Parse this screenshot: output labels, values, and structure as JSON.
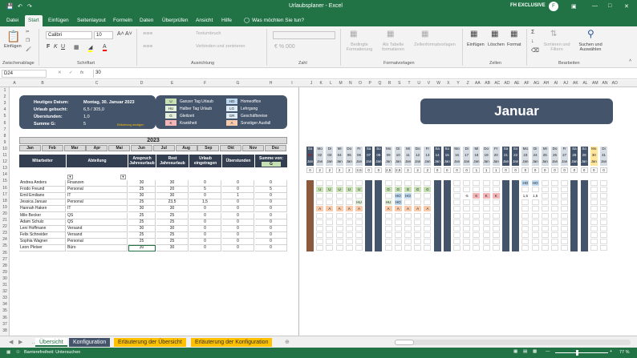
{
  "titlebar": {
    "autosave": "",
    "filename": "Urlaubsplaner - Excel",
    "user": "FH EXCLUSIVE"
  },
  "tabs": [
    "Datei",
    "Start",
    "Einfügen",
    "Seitenlayout",
    "Formeln",
    "Daten",
    "Überprüfen",
    "Ansicht",
    "Hilfe",
    "Was möchten Sie tun?"
  ],
  "ribbon": {
    "paste": "Einfügen",
    "font": "Calibri",
    "size": "10",
    "wrap": "Textumbruch",
    "merge": "Verbinden und zentrieren",
    "cond": "Bedingte Formatierung",
    "astable": "Als Tabelle formatieren",
    "cellstyles": "Zellenformatvorlagen",
    "insert": "Einfügen",
    "delete": "Löschen",
    "format": "Format",
    "sort": "Sortieren und Filtern",
    "find": "Suchen und Auswählen",
    "groups": [
      "Zwischenablage",
      "Schriftart",
      "Ausrichtung",
      "Zahl",
      "Formatvorlagen",
      "Zellen",
      "Bearbeiten"
    ]
  },
  "formula": {
    "namebox": "D24",
    "fx": "fx",
    "value": "30"
  },
  "columns": [
    "A",
    "B",
    "C",
    "D",
    "E",
    "F",
    "G",
    "H",
    "I",
    "J",
    "K",
    "L",
    "M",
    "N",
    "O",
    "P",
    "Q",
    "R",
    "S",
    "T",
    "U",
    "V",
    "W",
    "X",
    "Y",
    "Z",
    "AA",
    "AB",
    "AC",
    "AD",
    "AE",
    "AF",
    "AG",
    "AH",
    "AI",
    "AJ",
    "AK",
    "AL",
    "AM",
    "AN",
    "AO"
  ],
  "rows": [
    "1",
    "2",
    "3",
    "4",
    "5",
    "6",
    "7",
    "8",
    "9",
    "10",
    "11",
    "12",
    "13",
    "14",
    "15",
    "16",
    "17",
    "18",
    "19",
    "20",
    "21",
    "22",
    "23",
    "24",
    "25",
    "26",
    "27",
    "28",
    "29",
    "30",
    "31",
    "32",
    "33",
    "34",
    "35",
    "36",
    "37",
    "38"
  ],
  "info": {
    "labels": [
      "Heutiges Datum:",
      "Urlaub gebucht:",
      "Überstunden:",
      "Summe G:"
    ],
    "values": [
      "Montag, 30. Januar 2023",
      "6,5 / 305,0",
      "1,0",
      "5"
    ],
    "note": "Erläuterung anzeigen"
  },
  "legend": [
    {
      "code": "U",
      "text": "Ganzer Tag Urlaub",
      "color": "#c6e0b4"
    },
    {
      "code": "HU",
      "text": "Halber Tag Urlaub",
      "color": "#e2efda"
    },
    {
      "code": "G",
      "text": "Gleitzeit",
      "color": "#e2efda"
    },
    {
      "code": "K",
      "text": "Krankheit",
      "color": "#f4b6b6"
    },
    {
      "code": "HO",
      "text": "Homeoffice",
      "color": "#bdd7ee"
    },
    {
      "code": "LG",
      "text": "Lehrgang",
      "color": "#ddebf7"
    },
    {
      "code": "GR",
      "text": "Geschäftsreise",
      "color": "#ddebf7"
    },
    {
      "code": "A",
      "text": "Sonstiger Ausfall",
      "color": "#f8cbad"
    }
  ],
  "year": "2023",
  "months": [
    "Jan",
    "Feb",
    "Mar",
    "Apr",
    "Mai",
    "Jun",
    "Jul",
    "Aug",
    "Sep",
    "Okt",
    "Nov",
    "Dez"
  ],
  "month_title": "Januar",
  "headers": {
    "employee": "Mitarbeiter",
    "dept": "Abteilung",
    "claim": "Anspruch Jahresurlaub",
    "rest": "Rest Jahresurlaub",
    "booked": "Urlaub eingetragen",
    "overtime": "Überstunden",
    "sum": "Summe von:",
    "sumval": "G"
  },
  "employees": [
    {
      "name": "Andrea Anders",
      "dept": "Finanzen",
      "claim": "30",
      "rest": "30",
      "booked": "0",
      "ot": "0",
      "g": "0"
    },
    {
      "name": "Frodo Freund",
      "dept": "Personal",
      "claim": "25",
      "rest": "20",
      "booked": "5",
      "ot": "0",
      "g": "5"
    },
    {
      "name": "Emil Emiliano",
      "dept": "IT",
      "claim": "30",
      "rest": "30",
      "booked": "0",
      "ot": "1",
      "g": "0"
    },
    {
      "name": "Jessica Januar",
      "dept": "Personal",
      "claim": "25",
      "rest": "23,5",
      "booked": "1,5",
      "ot": "0",
      "g": "0"
    },
    {
      "name": "Hannah Haken",
      "dept": "IT",
      "claim": "30",
      "rest": "30",
      "booked": "0",
      "ot": "0",
      "g": "0"
    },
    {
      "name": "Mile Becker",
      "dept": "QS",
      "claim": "25",
      "rest": "25",
      "booked": "0",
      "ot": "0",
      "g": "0"
    },
    {
      "name": "Adam Schulz",
      "dept": "QS",
      "claim": "25",
      "rest": "25",
      "booked": "0",
      "ot": "0",
      "g": "0"
    },
    {
      "name": "Leni Hoffmann",
      "dept": "Versand",
      "claim": "30",
      "rest": "30",
      "booked": "0",
      "ot": "0",
      "g": "0"
    },
    {
      "name": "Felix Schneider",
      "dept": "Versand",
      "claim": "25",
      "rest": "25",
      "booked": "0",
      "ot": "0",
      "g": "0"
    },
    {
      "name": "Sophia Wagner",
      "dept": "Personal",
      "claim": "25",
      "rest": "25",
      "booked": "0",
      "ot": "0",
      "g": "0"
    },
    {
      "name": "Leon Pleiser",
      "dept": "Büro",
      "claim": "30",
      "rest": "30",
      "booked": "0",
      "ot": "0",
      "g": "0"
    }
  ],
  "cal": {
    "weekdays": [
      "So",
      "Mo",
      "Di",
      "Mi",
      "Do",
      "Fr",
      "Sa",
      "So",
      "Mo",
      "Di",
      "Mi",
      "Do",
      "Fr",
      "Sa",
      "So",
      "Mo",
      "Di",
      "Mi",
      "Do",
      "Fr",
      "Sa",
      "So",
      "Mo",
      "Di",
      "Mi",
      "Do",
      "Fr",
      "Sa",
      "So",
      "Mo",
      "Di"
    ],
    "dates": [
      "01",
      "02",
      "03",
      "04",
      "05",
      "06",
      "07",
      "08",
      "09",
      "10",
      "11",
      "12",
      "13",
      "14",
      "15",
      "16",
      "17",
      "18",
      "19",
      "20",
      "21",
      "22",
      "23",
      "24",
      "25",
      "26",
      "27",
      "28",
      "29",
      "30",
      "31"
    ],
    "mon": "Jan",
    "counts": [
      "0",
      "2",
      "2",
      "2",
      "2",
      "2,5",
      "0",
      "0",
      "2,5",
      "2,5",
      "2",
      "2",
      "2",
      "0",
      "0",
      "0",
      "0",
      "1",
      "1",
      "1",
      "0",
      "0",
      "0",
      "0",
      "0",
      "0",
      "0",
      "0",
      "0",
      "0",
      "0"
    ]
  },
  "marks": [
    {
      "r": 0,
      "d": 22,
      "v": "HO",
      "c": "#bdd7ee"
    },
    {
      "r": 0,
      "d": 23,
      "v": "HO",
      "c": "#bdd7ee"
    },
    {
      "r": 1,
      "d": 1,
      "v": "U",
      "c": "#c6e0b4"
    },
    {
      "r": 1,
      "d": 2,
      "v": "U",
      "c": "#c6e0b4"
    },
    {
      "r": 1,
      "d": 3,
      "v": "U",
      "c": "#c6e0b4"
    },
    {
      "r": 1,
      "d": 4,
      "v": "U",
      "c": "#c6e0b4"
    },
    {
      "r": 1,
      "d": 5,
      "v": "U",
      "c": "#c6e0b4"
    },
    {
      "r": 1,
      "d": 8,
      "v": "G",
      "c": "#c6e0b4"
    },
    {
      "r": 1,
      "d": 9,
      "v": "G",
      "c": "#c6e0b4"
    },
    {
      "r": 1,
      "d": 10,
      "v": "G",
      "c": "#c6e0b4"
    },
    {
      "r": 1,
      "d": 11,
      "v": "G",
      "c": "#c6e0b4"
    },
    {
      "r": 1,
      "d": 12,
      "v": "G",
      "c": "#c6e0b4"
    },
    {
      "r": 2,
      "d": 9,
      "v": "HO",
      "c": "#bdd7ee"
    },
    {
      "r": 2,
      "d": 10,
      "v": "HO",
      "c": "#bdd7ee"
    },
    {
      "r": 2,
      "d": 16,
      "v": "-5",
      "c": "#ffffff"
    },
    {
      "r": 2,
      "d": 17,
      "v": "K",
      "c": "#f4b6b6"
    },
    {
      "r": 2,
      "d": 18,
      "v": "K",
      "c": "#f4b6b6"
    },
    {
      "r": 2,
      "d": 19,
      "v": "K",
      "c": "#f4b6b6"
    },
    {
      "r": 2,
      "d": 22,
      "v": "1,5",
      "c": "#ffffff"
    },
    {
      "r": 2,
      "d": 23,
      "v": "1,5",
      "c": "#ffffff"
    },
    {
      "r": 3,
      "d": 5,
      "v": "HU",
      "c": "#e2efda"
    },
    {
      "r": 3,
      "d": 8,
      "v": "HU",
      "c": "#e2efda"
    },
    {
      "r": 3,
      "d": 9,
      "v": "HO",
      "c": "#bdd7ee"
    },
    {
      "r": 4,
      "d": 1,
      "v": "A",
      "c": "#f8cbad"
    },
    {
      "r": 4,
      "d": 2,
      "v": "A",
      "c": "#f8cbad"
    },
    {
      "r": 4,
      "d": 3,
      "v": "A",
      "c": "#f8cbad"
    },
    {
      "r": 4,
      "d": 4,
      "v": "A",
      "c": "#f8cbad"
    },
    {
      "r": 4,
      "d": 5,
      "v": "A",
      "c": "#f8cbad"
    },
    {
      "r": 4,
      "d": 8,
      "v": "A",
      "c": "#f8cbad"
    },
    {
      "r": 4,
      "d": 9,
      "v": "A",
      "c": "#f8cbad"
    },
    {
      "r": 4,
      "d": 10,
      "v": "A",
      "c": "#f8cbad"
    },
    {
      "r": 4,
      "d": 11,
      "v": "A",
      "c": "#f8cbad"
    },
    {
      "r": 4,
      "d": 12,
      "v": "A",
      "c": "#f8cbad"
    }
  ],
  "sheets": [
    {
      "name": "Übersicht",
      "color": "#ffffff"
    },
    {
      "name": "Konfiguration",
      "color": "#44546a"
    },
    {
      "name": "Erläuterung der Übersicht",
      "color": "#ffc000"
    },
    {
      "name": "Erläuterung der Konfiguration",
      "color": "#ffc000"
    }
  ],
  "status": {
    "left": "Barrierefreiheit: Untersuchen",
    "zoom": "77 %"
  }
}
